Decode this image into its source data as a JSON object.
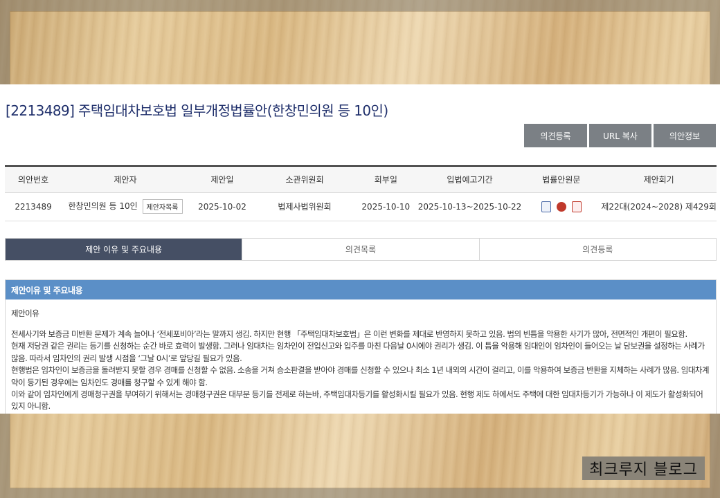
{
  "bill": {
    "title": "[2213489] 주택임대차보호법 일부개정법률안(한창민의원 등 10인)"
  },
  "actions": {
    "opinion_register": "의견등록",
    "url_copy": "URL 복사",
    "bill_info": "의안정보"
  },
  "info_table": {
    "headers": [
      "의안번호",
      "제안자",
      "제안일",
      "소관위원회",
      "회부일",
      "입법예고기간",
      "법률안원문",
      "제안회기"
    ],
    "row": {
      "bill_no": "2213489",
      "proposer": "한창민의원 등 10인",
      "proposer_list_btn": "제안자목록",
      "proposal_date": "2025-10-02",
      "committee": "법제사법위원회",
      "referral_date": "2025-10-10",
      "notice_period": "2025-10-13~2025-10-22",
      "session": "제22대(2024~2028) 제429회"
    },
    "file_icons": [
      "document-search-icon",
      "hwp-file-icon",
      "pdf-file-icon"
    ]
  },
  "tabs": [
    "제안 이유 및 주요내용",
    "의견목록",
    "의견등록"
  ],
  "content": {
    "section_title": "제안이유 및 주요내용",
    "subheading": "제안이유",
    "paragraphs": [
      "전세사기와 보증금 미반환 문제가 계속 늘어나 ‘전세포비아’라는 말까지 생김. 하지만 현행 「주택임대차보호법」은 이런 변화를 제대로 반영하지 못하고 있음. 법의 빈틈을 악용한 사기가 많아, 전면적인 개편이 필요함.",
      "현재 저당권 같은 권리는 등기를 신청하는 순간 바로 효력이 발생함. 그러나 임대차는 임차인이 전입신고와 입주를 마친 다음날 0시에야 권리가 생김. 이 틈을 악용해 임대인이 임차인이 들어오는 날 담보권을 설정하는 사례가 많음. 따라서 임차인의 권리 발생 시점을 ‘그날 0시’로 앞당길 필요가 있음.",
      "현행법은 임차인이 보증금을 돌려받지 못할 경우 경매를 신청할 수 없음. 소송을 거쳐 승소판결을 받아야 경매를 신청할 수 있으나 최소 1년 내외의 시간이 걸리고, 이를 악용하여 보증금 반환을 지체하는 사례가 많음. 임대차계약이 등기된 경우에는 임차인도 경매를 청구할 수 있게 해야 함.",
      "이와 같이 임차인에게 경매청구권을 부여하기 위해서는 경매청구권은 대부분 등기를 전제로 하는바, 주택임대차등기를 활성화시킬 필요가 있음. 현행 제도 하에서도 주택에 대한 임대차등기가 가능하나 이 제도가 활성화되어 있지 아니함."
    ]
  },
  "watermark": "최크루지 블로그"
}
